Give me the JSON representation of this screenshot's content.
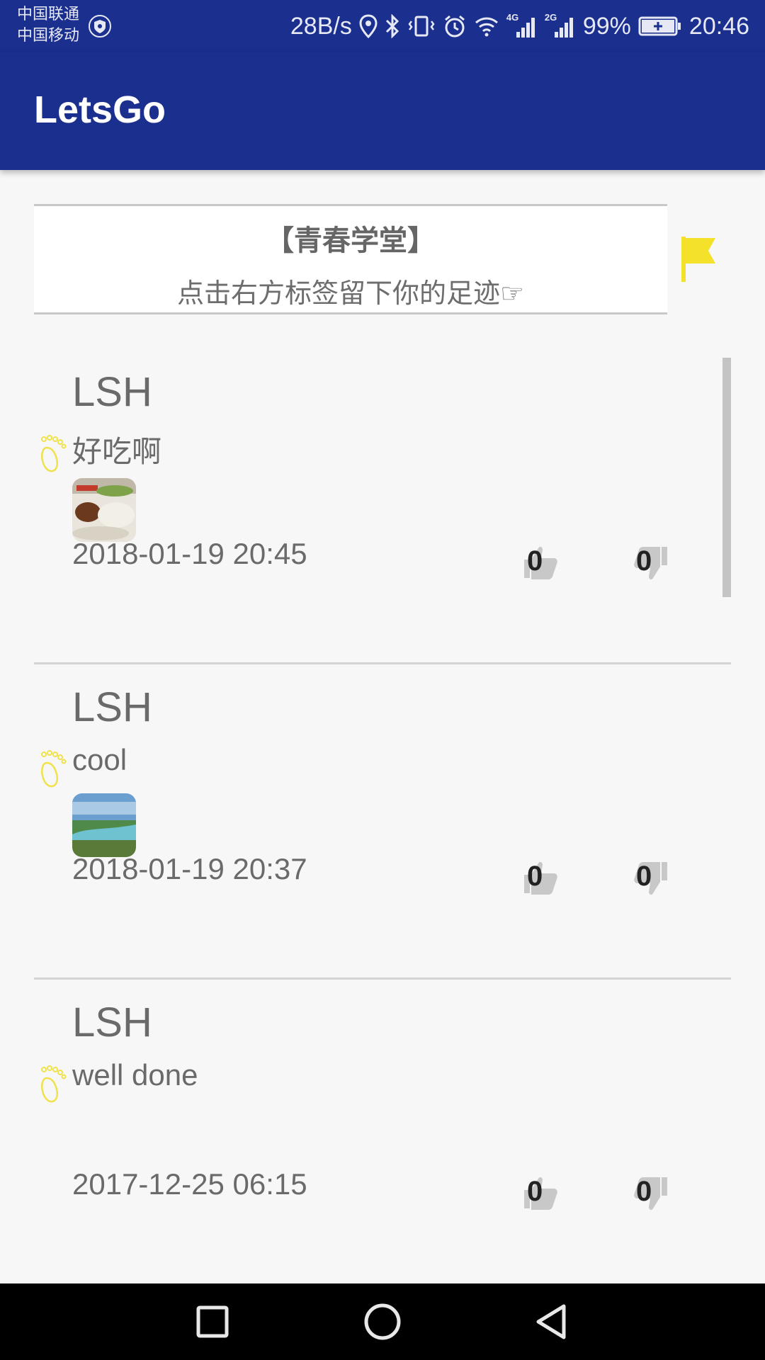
{
  "status_bar": {
    "carrier_1": "中国联通",
    "carrier_2": "中国移动",
    "net_speed": "28B/s",
    "net_4g": "4G",
    "net_2g": "2G",
    "battery": "99%",
    "time": "20:46"
  },
  "app_bar": {
    "title": "LetsGo"
  },
  "board": {
    "title": "【青春学堂】",
    "subtitle": "点击右方标签留下你的足迹☞"
  },
  "posts": [
    {
      "author": "LSH",
      "text": "好吃啊",
      "image": "food-photo",
      "time": "2018-01-19 20:45",
      "likes": "0",
      "dislikes": "0"
    },
    {
      "author": "LSH",
      "text": "cool",
      "image": "lake-landscape-photo",
      "time": "2018-01-19 20:37",
      "likes": "0",
      "dislikes": "0"
    },
    {
      "author": "LSH",
      "text": "well done",
      "image": "",
      "time": "2017-12-25 06:15",
      "likes": "0",
      "dislikes": "0"
    }
  ],
  "icons": {
    "flag": "flag-icon",
    "footprint": "footprint-icon",
    "like": "thumbs-up-icon",
    "dislike": "thumbs-down-icon"
  },
  "colors": {
    "app_bar": "#1a2f8e",
    "flag": "#f4e12a",
    "footprint": "#efe24a",
    "background": "#f7f7f7"
  }
}
